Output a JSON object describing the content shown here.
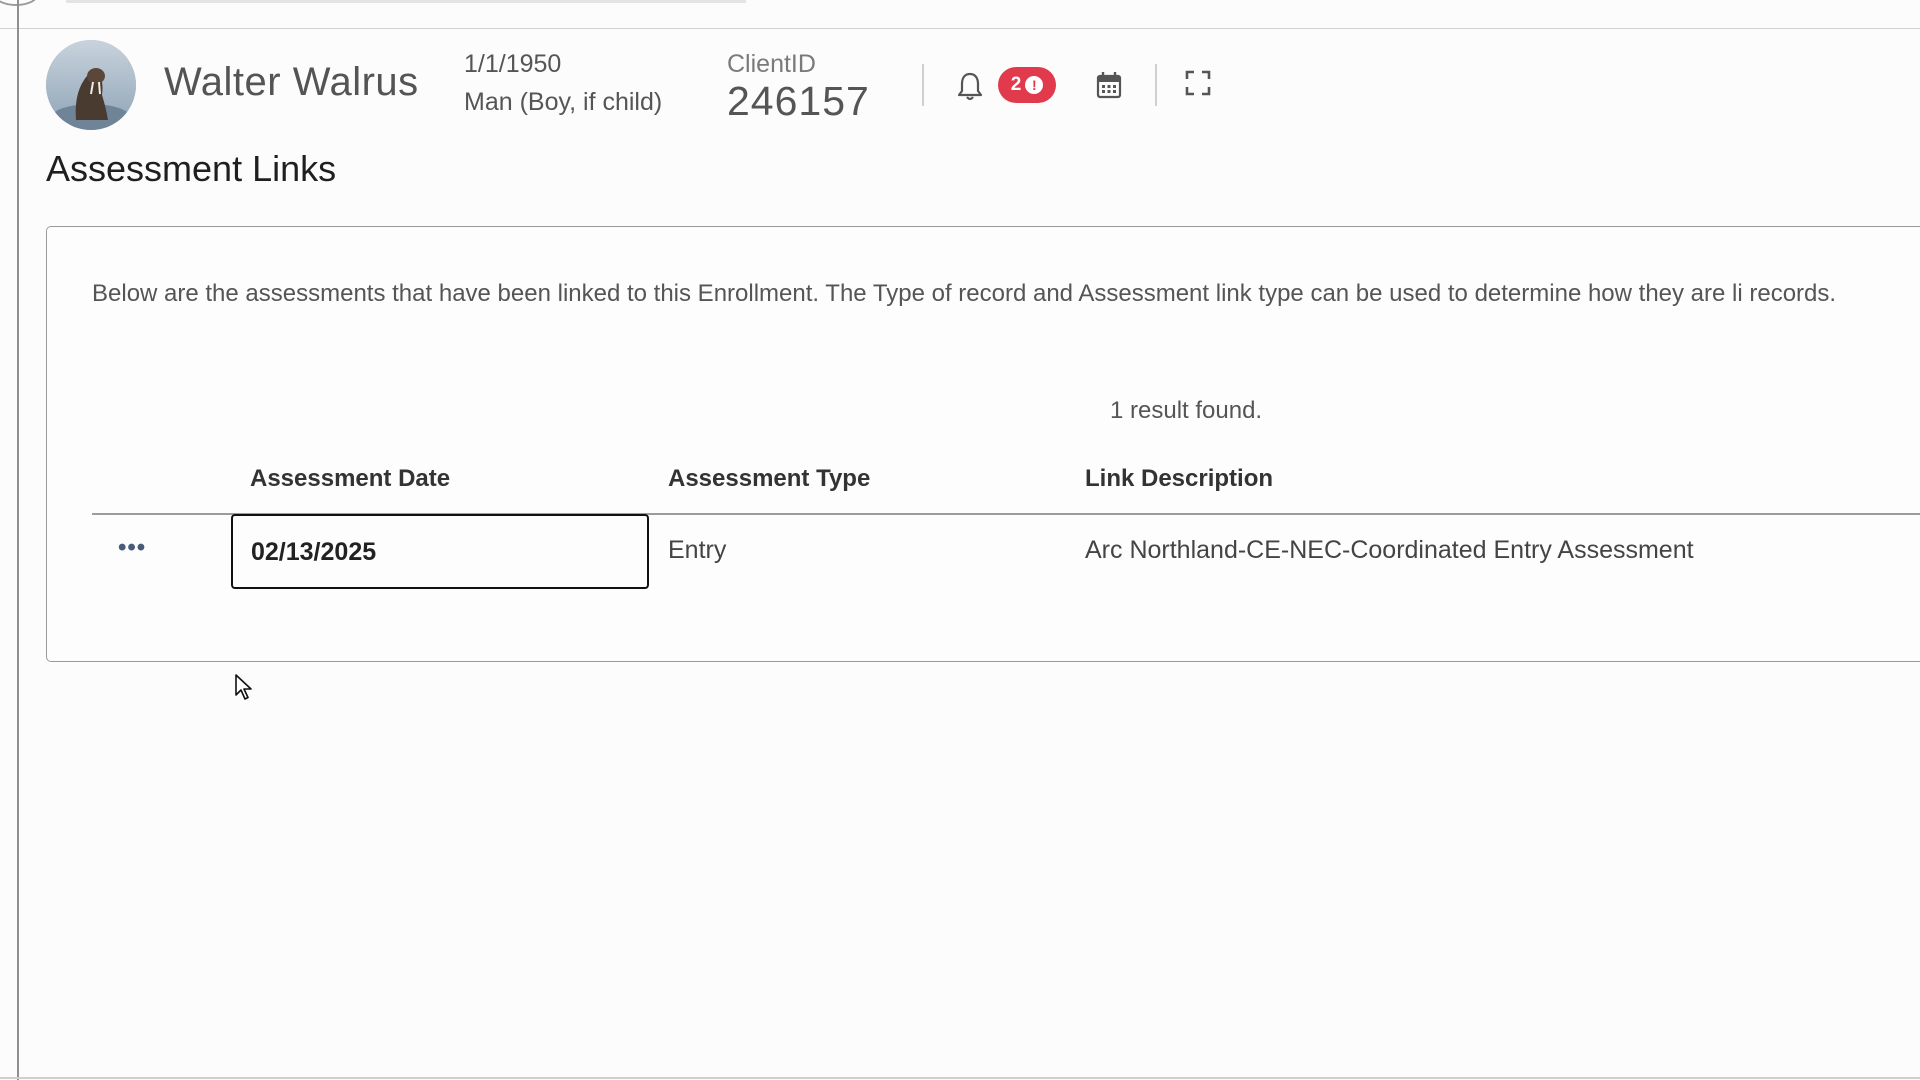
{
  "client": {
    "name": "Walter Walrus",
    "dob": "1/1/1950",
    "gender": "Man (Boy, if child)",
    "client_id_label": "ClientID",
    "client_id": "246157"
  },
  "notifications": {
    "count": "2",
    "alert_glyph": "!"
  },
  "page": {
    "title": "Assessment Links",
    "intro": "Below are the assessments that have been linked to this Enrollment.  The Type of record and Assessment link type can be used to determine how they are li records.",
    "result_count": "1 result found."
  },
  "table": {
    "columns": [
      "Assessment Date",
      "Assessment Type",
      "Link Description"
    ],
    "rows": [
      {
        "actions": "•••",
        "date": "02/13/2025",
        "type": "Entry",
        "description": "Arc Northland-CE-NEC-Coordinated Entry Assessment"
      }
    ]
  },
  "icons": [
    "bell-icon",
    "calendar-icon",
    "expand-icon",
    "more-actions-icon",
    "mouse-cursor"
  ],
  "colors": {
    "badge": "#e03a4c",
    "border": "#9a9a9a",
    "text": "#555555"
  }
}
